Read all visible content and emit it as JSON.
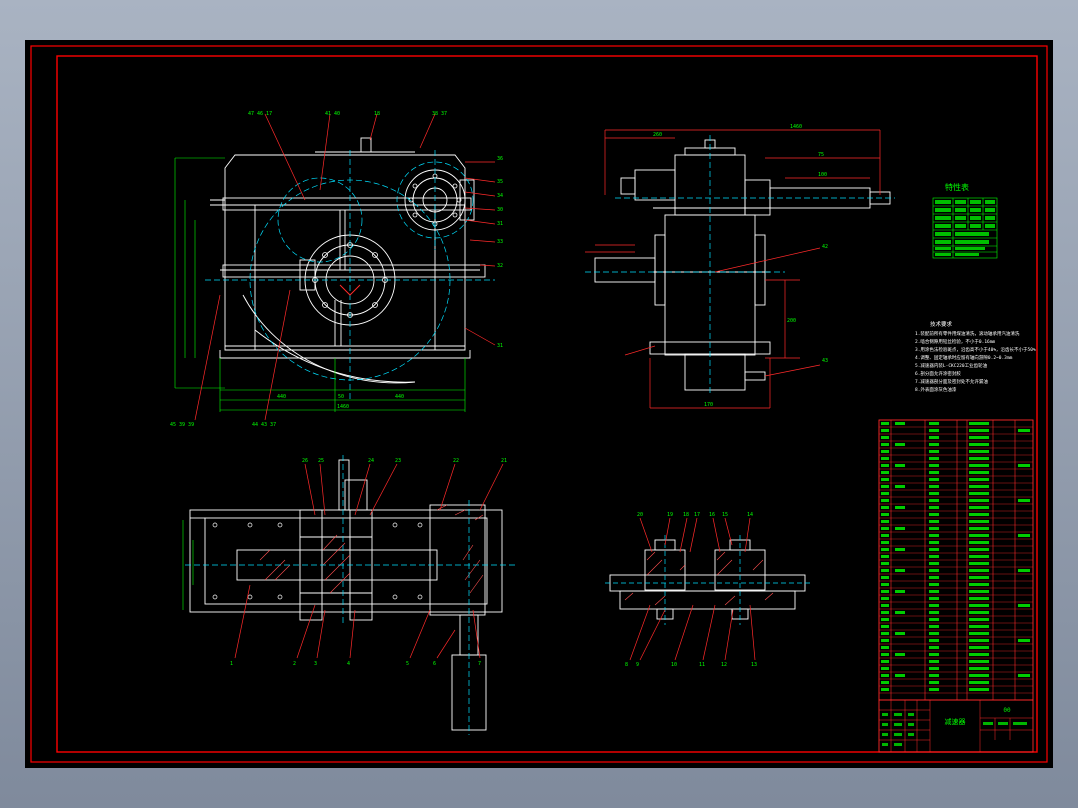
{
  "titles": {
    "char_table_title": "特性表",
    "tech_req_title": "技术要求",
    "drawing_title": "减速器",
    "drawing_code": "00"
  },
  "colors": {
    "page_bg": "#8f9aab",
    "drawing_bg": "#000000",
    "frame": "#ff0000",
    "outline": "#ffffff",
    "dimension": "#00ff00",
    "leader": "#ff2a2a",
    "centerline": "#00e0ff",
    "hatch": "#ff5050"
  },
  "front_view": {
    "top_labels": [
      "47 46 17",
      "41 40",
      "18",
      "38 37"
    ],
    "right_labels": [
      "36",
      "35",
      "34",
      "30",
      "31",
      "33",
      "32",
      "31"
    ],
    "bottom_left_labels": "45 39 39",
    "bottom_mid_labels": "44 43 37",
    "dims": [
      "440",
      "50",
      "440",
      "1460"
    ]
  },
  "side_view": {
    "labels": [
      "42",
      "43"
    ],
    "dims": [
      "1460",
      "260",
      "75",
      "100",
      "170",
      "200"
    ]
  },
  "plan_view": {
    "top_labels": [
      "26",
      "25",
      "24",
      "23",
      "22",
      "21"
    ],
    "bottom_labels": [
      "1",
      "2",
      "3",
      "4",
      "5",
      "6",
      "7"
    ]
  },
  "detail_view": {
    "top_labels": [
      "20",
      "19",
      "18",
      "17",
      "16",
      "15",
      "14"
    ],
    "bottom_labels": [
      "8",
      "9",
      "10",
      "11",
      "12",
      "13"
    ]
  },
  "tech_requirements": [
    "1.装配前所有零件用煤油清洗，滚动轴承用汽油清洗",
    "2.啮合侧隙用铅丝检验，不小于0.16mm",
    "3.用涂色法检验斑点，沿齿高不小于40%，沿齿长不小于50%",
    "4.调整、固定轴承时应留有轴向游隙0.2~0.3mm",
    "5.减速器内装L-CKC220工业齿轮油",
    "6.剖分面允许涂密封胶",
    "7.减速器剖分面及密封处不允许漏油",
    "8.外表面涂灰色油漆"
  ]
}
